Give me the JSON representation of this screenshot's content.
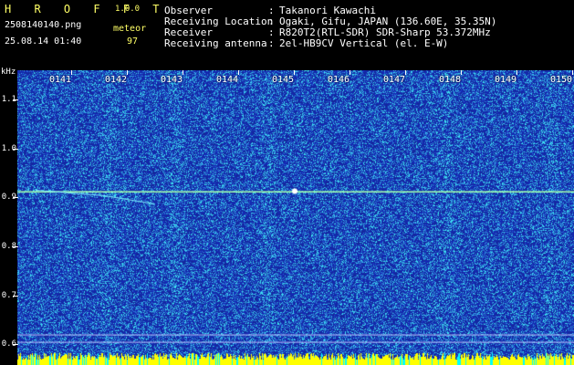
{
  "app": {
    "logo": "H R O F F T",
    "version": "1.0.0"
  },
  "file": {
    "name": "2508140140.png",
    "datetime": "25.08.14 01:40"
  },
  "detector": {
    "label": "meteor",
    "count": "97"
  },
  "info": [
    {
      "key": "Observer",
      "sep": ":",
      "value": "Takanori Kawachi"
    },
    {
      "key": "Receiving Location",
      "sep": ":",
      "value": "Ogaki, Gifu, JAPAN (136.60E, 35.35N)"
    },
    {
      "key": "Receiver",
      "sep": ":",
      "value": "R820T2(RTL-SDR) SDR-Sharp 53.372MHz"
    },
    {
      "key": "Receiving antenna",
      "sep": ":",
      "value": "2el-HB9CV Vertical (el. E-W)"
    }
  ],
  "spectrogram": {
    "unit": "kHz",
    "y_ticks": [
      "1.1",
      "1.0",
      "0.9",
      "0.8",
      "0.7",
      "0.6"
    ],
    "y_range": [
      0.58,
      1.16
    ],
    "x_ticks": [
      "0141",
      "0142",
      "0143",
      "0144",
      "0145",
      "0146",
      "0147",
      "0148",
      "0149",
      "0150"
    ],
    "carrier_khz": 0.913,
    "colors": {
      "background": "#1a2aa0",
      "noise": "#5fd0ff",
      "signal": "#a0ffb0",
      "bottom": "#ffff00"
    }
  }
}
